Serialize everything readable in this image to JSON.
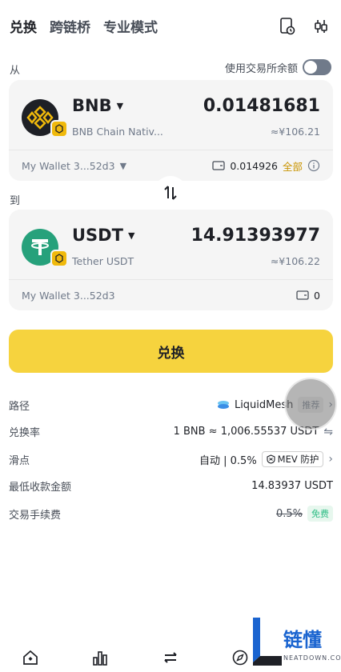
{
  "tabs": [
    "兑换",
    "跨链桥",
    "专业模式"
  ],
  "from_label": "从",
  "to_label": "到",
  "use_exchange_balance": "使用交易所余额",
  "from": {
    "symbol": "BNB",
    "chain": "BNB Chain Nativ...",
    "amount": "0.01481681",
    "fiat": "≈¥106.21",
    "wallet": "My Wallet 3...52d3",
    "balance": "0.014926",
    "all": "全部"
  },
  "to": {
    "symbol": "USDT",
    "chain": "Tether USDT",
    "amount": "14.91393977",
    "fiat": "≈¥106.22",
    "wallet": "My Wallet 3...52d3",
    "balance": "0"
  },
  "cta_label": "兑换",
  "info": {
    "route_key": "路径",
    "route_value": "LiquidMesh",
    "route_tag": "推荐",
    "rate_key": "兑换率",
    "rate_value": "1 BNB ≈ 1,006.55537 USDT",
    "slippage_key": "滑点",
    "slippage_value": "自动 | 0.5%",
    "mev": "MEV 防护",
    "min_key": "最低收款金额",
    "min_value": "14.83937 USDT",
    "fee_key": "交易手续费",
    "fee_value": "0.5%",
    "fee_tag": "免费"
  },
  "watermark": {
    "text": "链懂",
    "sub": "NEATDOWN.COM"
  },
  "colors": {
    "accent": "#f6d33e",
    "bnb": "#f0b90b",
    "usdt": "#26a17b",
    "brand_blue": "#1a64d0"
  }
}
